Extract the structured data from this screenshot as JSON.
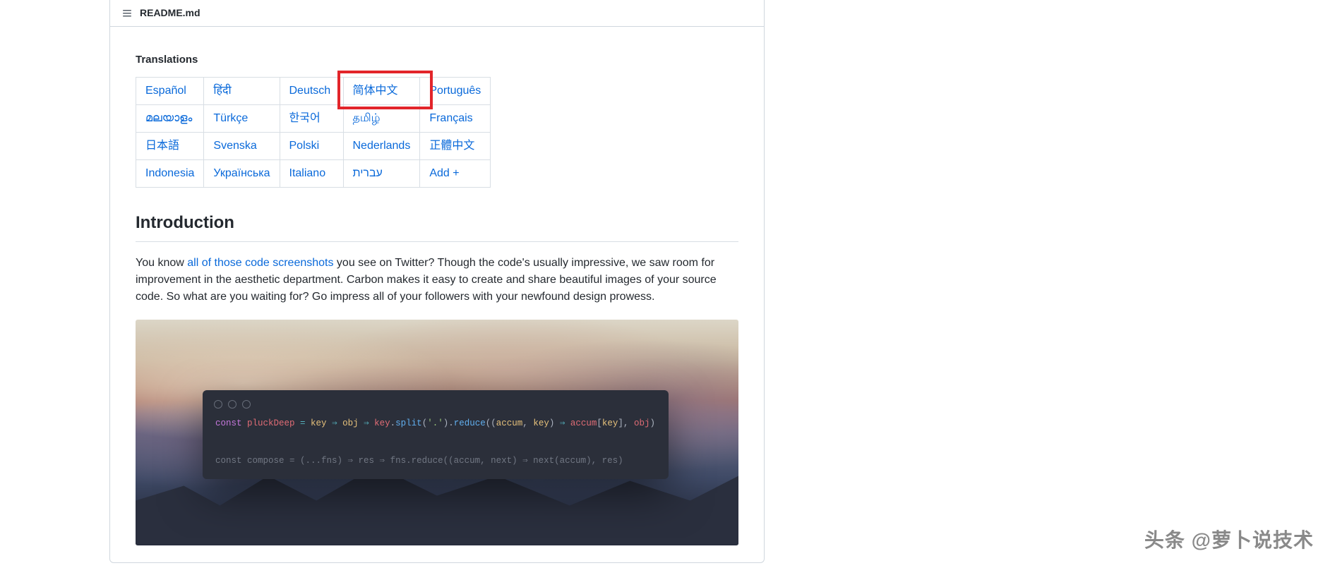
{
  "readme": {
    "filename": "README.md",
    "translations_label": "Translations",
    "translations": [
      [
        "Español",
        "हिंदी",
        "Deutsch",
        "简体中文",
        "Português"
      ],
      [
        "മലയാളം",
        "Türkçe",
        "한국어",
        "தமிழ்",
        "Français"
      ],
      [
        "日本語",
        "Svenska",
        "Polski",
        "Nederlands",
        "正體中文"
      ],
      [
        "Indonesia",
        "Українська",
        "Italiano",
        "עברית",
        "Add +"
      ]
    ],
    "highlighted_cell": {
      "row": 0,
      "col": 3
    },
    "introduction_heading": "Introduction",
    "intro_text_before_link": "You know ",
    "intro_link_text": "all of those code screenshots",
    "intro_text_after_link": " you see on Twitter? Though the code's usually impressive, we saw room for improvement in the aesthetic department. Carbon makes it easy to create and share beautiful images of your source code. So what are you waiting for? Go impress all of your followers with your newfound design prowess."
  },
  "code_snippet": {
    "line1": {
      "kw": "const",
      "name": " pluckDeep ",
      "eq": "= ",
      "p1": "key",
      "arrow1": " ⇒ ",
      "p2": "obj",
      "arrow2": " ⇒ ",
      "call1": "key",
      "dot1": ".",
      "fn1": "split",
      "open1": "(",
      "str1": "'.'",
      "close1": ")",
      "dot2": ".",
      "fn2": "reduce",
      "open2": "((",
      "p3": "accum",
      "comma1": ", ",
      "p4": "key",
      "close2paren": ") ",
      "arrow3": "⇒ ",
      "acc": "accum",
      "br1": "[",
      "keyref": "key",
      "br2": "], ",
      "objref": "obj",
      "close3": ")"
    },
    "line2_raw": "const compose = (...fns) ⇒ res ⇒ fns.reduce((accum, next) ⇒ next(accum), res)"
  },
  "watermark": "头条 @萝卜说技术"
}
